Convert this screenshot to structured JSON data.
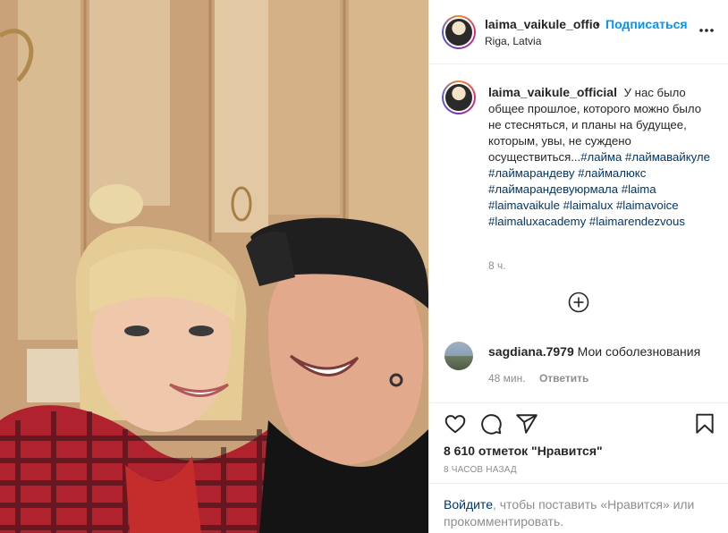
{
  "header": {
    "username": "laima_vaikule_offic",
    "dot": "•",
    "follow_label": "Подписаться",
    "location": "Riga, Latvia",
    "more_icon": "more-horizontal-icon"
  },
  "caption": {
    "username": "laima_vaikule_official",
    "text": "У нас было общее прошлое, которого можно было не стесняться, и планы на будущее, которым, увы, не суждено осуществиться...",
    "hashtags": [
      "#лайма",
      "#лаймавайкуле",
      "#лаймарандеву",
      "#лаймалюкс",
      "#лаймарандевуюрмала",
      "#laima",
      "#laimavaikule",
      "#laimalux",
      "#laimavoice",
      "#laimaluxacademy",
      "#laimarendezvous"
    ],
    "time": "8 ч."
  },
  "load_more_icon": "plus-circle-icon",
  "comment": {
    "username": "sagdiana.7979",
    "text": "Мои соболезнования",
    "time": "48 мин.",
    "reply_label": "Ответить"
  },
  "actions": {
    "icons": [
      "heart-icon",
      "comment-icon",
      "share-icon",
      "bookmark-icon"
    ],
    "likes": "8 610 отметок \"Нравится\"",
    "date": "8 ЧАСОВ НАЗАД"
  },
  "login": {
    "link": "Войдите",
    "text": ", чтобы поставить «Нравится» или прокомментировать."
  },
  "colors": {
    "link_blue": "#0095f6",
    "hashtag": "#00376b",
    "secondary": "#8e8e8e"
  }
}
